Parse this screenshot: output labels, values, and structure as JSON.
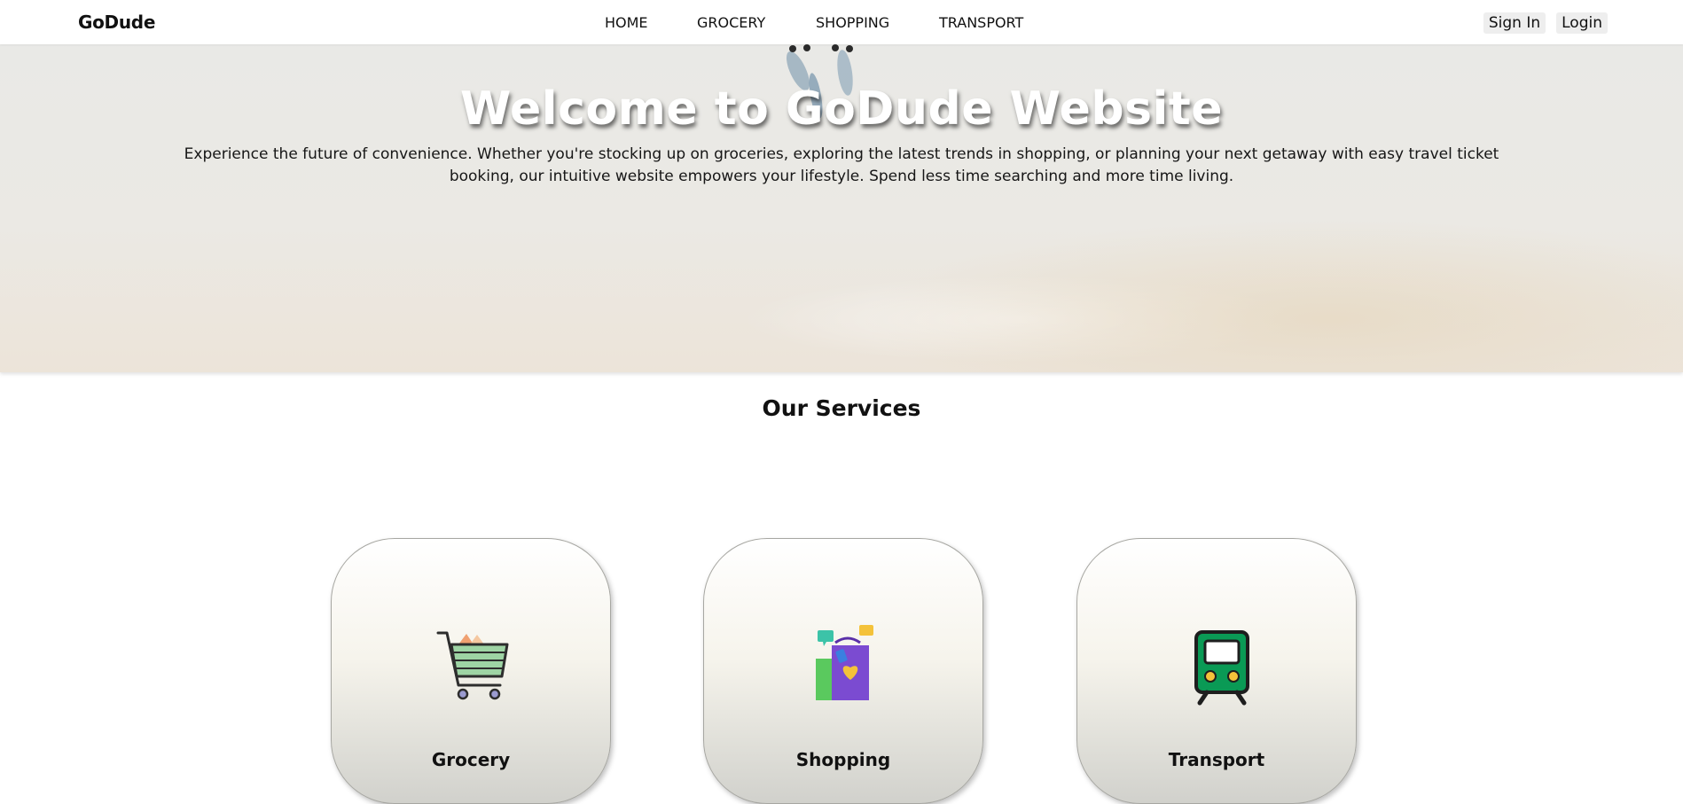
{
  "nav": {
    "brand": "GoDude",
    "links": [
      "HOME",
      "GROCERY",
      "SHOPPING",
      "TRANSPORT"
    ],
    "sign_in": "Sign In",
    "login": "Login"
  },
  "hero": {
    "title": "Welcome to GoDude Website",
    "description": "Experience the future of convenience. Whether you're stocking up on groceries, exploring the latest trends in shopping, or planning your next getaway with easy travel ticket booking, our intuitive website empowers your lifestyle. Spend less time searching and more time living."
  },
  "services": {
    "heading": "Our Services",
    "cards": [
      {
        "label": "Grocery",
        "icon": "shopping-cart-icon"
      },
      {
        "label": "Shopping",
        "icon": "shopping-bags-icon"
      },
      {
        "label": "Transport",
        "icon": "train-icon"
      }
    ]
  },
  "colors": {
    "icon_green": "#0a9a55",
    "bag_purple": "#7b4bd1",
    "cart_fill": "#9ed4a4"
  }
}
